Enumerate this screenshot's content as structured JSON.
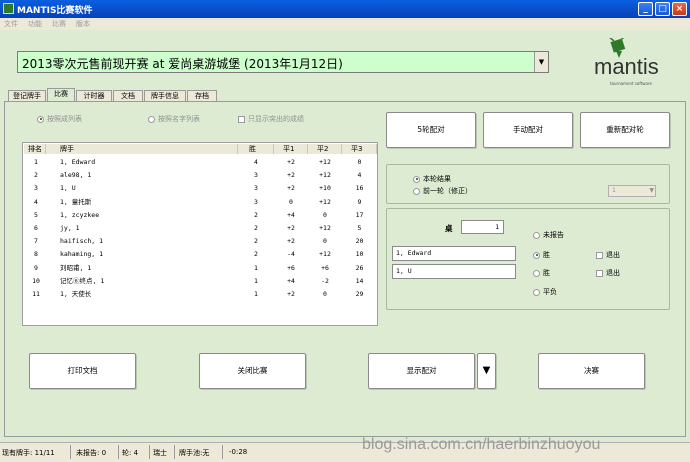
{
  "window": {
    "title": "MANTIS比赛软件",
    "controls": {
      "minimize": "_",
      "maximize": "□",
      "close": "×"
    }
  },
  "menu": [
    "文件",
    "功能",
    "比赛",
    "版本"
  ],
  "event": {
    "selected": "2013零次元售前现开赛 at 爱尚桌游城堡 (2013年1月12日)",
    "dropdown_glyph": "▼"
  },
  "logo": {
    "text": "mantis",
    "subtitle": "tournament software"
  },
  "tabs": [
    "登记牌手",
    "比赛",
    "计时器",
    "文档",
    "牌手信息",
    "存档"
  ],
  "active_tab": 1,
  "view_options": {
    "by_rank": "按照成列表",
    "by_name": "按照名字列表",
    "hide_dropped": "只显示突出的成绩"
  },
  "standings": {
    "columns": [
      "排名",
      "牌手",
      "胜",
      "平1",
      "平2",
      "平3"
    ],
    "rows": [
      [
        "1",
        "1, Edward",
        "4",
        "+2",
        "+12",
        "0"
      ],
      [
        "2",
        "ale98, 1",
        "3",
        "+2",
        "+12",
        "4"
      ],
      [
        "3",
        "1, U",
        "3",
        "+2",
        "+10",
        "16"
      ],
      [
        "4",
        "1, 童托斯",
        "3",
        "0",
        "+12",
        "9"
      ],
      [
        "5",
        "1, zcyzkee",
        "2",
        "+4",
        "0",
        "17"
      ],
      [
        "6",
        "jy, 1",
        "2",
        "+2",
        "+12",
        "5"
      ],
      [
        "7",
        "haifisch, 1",
        "2",
        "+2",
        "0",
        "20"
      ],
      [
        "8",
        "kahaming, 1",
        "2",
        "-4",
        "+12",
        "10"
      ],
      [
        "9",
        "刘昭甫, 1",
        "1",
        "+6",
        "+6",
        "26"
      ],
      [
        "10",
        "记忆⑥终点, 1",
        "1",
        "+4",
        "-2",
        "14"
      ],
      [
        "11",
        "1, 天使长",
        "1",
        "+2",
        "0",
        "29"
      ]
    ]
  },
  "pairing_buttons": {
    "swiss": "5轮配对",
    "manual": "手动配对",
    "repair": "重新配对轮"
  },
  "round_options": {
    "current": "本轮结果",
    "previous": "前一轮（修正）",
    "round_select_value": "1",
    "round_drop_glyph": "▼"
  },
  "result": {
    "table_label": "桌",
    "table_number": "1",
    "player1": "1, Edward",
    "player2": "1, U",
    "not_reported": "未报告",
    "win": "胜",
    "draw": "平负",
    "drop": "退出"
  },
  "bottom_buttons": {
    "print": "打印文档",
    "close_event": "关闭比赛",
    "show_pairings": "显示配对",
    "show_pairings_drop": "▼",
    "finals": "决赛"
  },
  "status": {
    "players": "现有牌手: 11/11",
    "unreported": "未报告: 0",
    "round": "轮: 4",
    "system": "瑞士",
    "pool": "牌手池:无",
    "timer": "-0:28"
  },
  "watermark": "blog.sina.com.cn/haerbinzhuoyou",
  "colors": {
    "titlebar": "#0a5fe0",
    "panel": "#dcebd2",
    "event_field": "#ccffcc",
    "logo_green": "#2f7a2a"
  }
}
